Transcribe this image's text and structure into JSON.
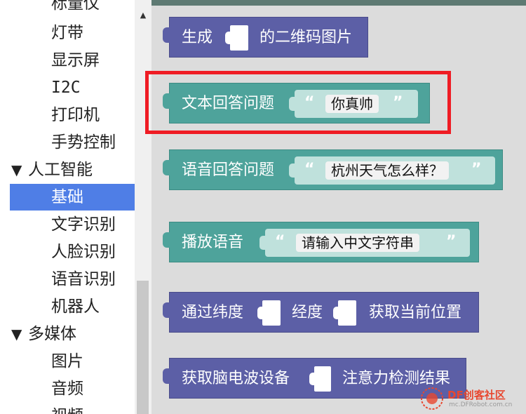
{
  "sidebar": {
    "items": [
      {
        "label": "标量仪",
        "level": "sub"
      },
      {
        "label": "灯带",
        "level": "sub"
      },
      {
        "label": "显示屏",
        "level": "sub"
      },
      {
        "label": "I2C",
        "level": "sub"
      },
      {
        "label": "打印机",
        "level": "sub"
      },
      {
        "label": "手势控制",
        "level": "sub"
      },
      {
        "label": "人工智能",
        "level": "head",
        "expanded": true
      },
      {
        "label": "基础",
        "level": "sub",
        "selected": true
      },
      {
        "label": "文字识别",
        "level": "sub"
      },
      {
        "label": "人脸识别",
        "level": "sub"
      },
      {
        "label": "语音识别",
        "level": "sub"
      },
      {
        "label": "机器人",
        "level": "sub"
      },
      {
        "label": "多媒体",
        "level": "head",
        "expanded": true
      },
      {
        "label": "图片",
        "level": "sub"
      },
      {
        "label": "音频",
        "level": "sub"
      },
      {
        "label": "视频",
        "level": "sub"
      }
    ],
    "expand_glyph": "▼",
    "selected_color": "#4f7ee6"
  },
  "scrollbar": {
    "up_glyph": "▲"
  },
  "blocks": {
    "b1": {
      "label1": "生成",
      "label2": "的二维码图片",
      "color": "#5c5fa6"
    },
    "b2": {
      "label": "文本回答问题",
      "value": "你真帅",
      "open_quote": "“",
      "close_quote": "”",
      "color": "#4ea39b"
    },
    "b3": {
      "label": "语音回答问题",
      "value": "杭州天气怎么样？",
      "open_quote": "“",
      "close_quote": "”",
      "color": "#4ea39b"
    },
    "b4": {
      "label": "播放语音",
      "value": "请输入中文字符串",
      "open_quote": "“",
      "close_quote": "”",
      "color": "#4ea39b"
    },
    "b5": {
      "label1": "通过纬度",
      "label2": "经度",
      "label3": "获取当前位置",
      "color": "#5c5fa6"
    },
    "b6": {
      "label1": "获取脑电波设备",
      "label2": "注意力检测结果",
      "color": "#5c5fa6"
    }
  },
  "highlight_color": "#ef1c24",
  "watermark": {
    "main": "DF创客社区",
    "sub": "mc.DFRobot.com.cn"
  }
}
